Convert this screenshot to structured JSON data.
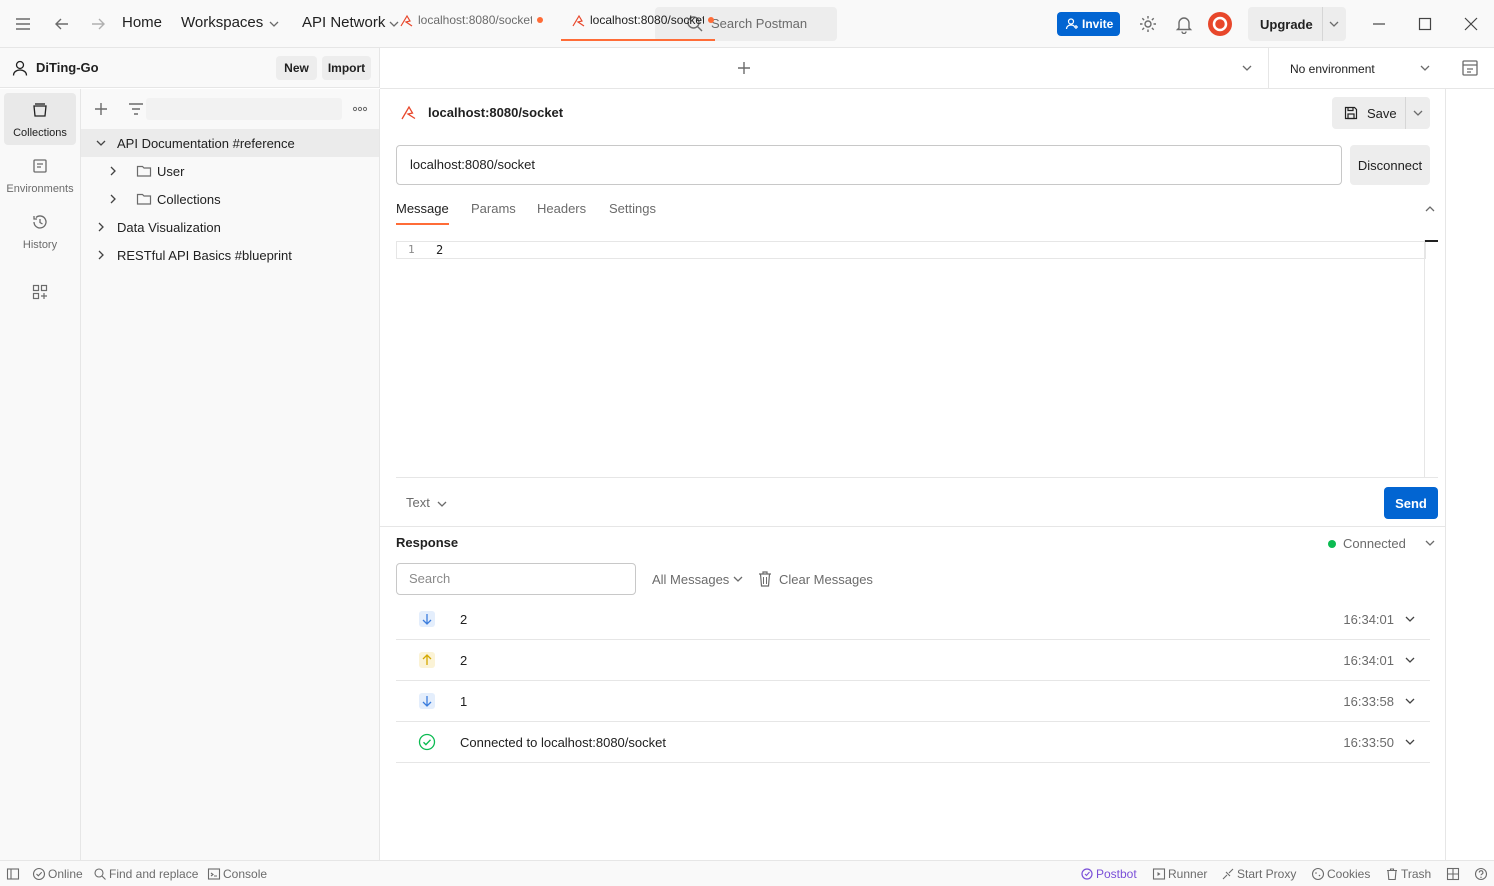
{
  "titlebar": {
    "home": "Home",
    "workspaces": "Workspaces",
    "api_network": "API Network",
    "search_placeholder": "Search Postman",
    "invite": "Invite",
    "upgrade": "Upgrade"
  },
  "workspace": {
    "name": "DiTing-Go",
    "new_label": "New",
    "import_label": "Import"
  },
  "rail": [
    {
      "label": "Collections"
    },
    {
      "label": "Environments"
    },
    {
      "label": "History"
    }
  ],
  "tree": [
    {
      "label": "API Documentation #reference"
    },
    {
      "label": "User"
    },
    {
      "label": "Collections"
    },
    {
      "label": "Data Visualization"
    },
    {
      "label": "RESTful API Basics #blueprint"
    }
  ],
  "tabs": [
    {
      "label": "localhost:8080/socket"
    },
    {
      "label": "localhost:8080/socket"
    }
  ],
  "environment": "No environment",
  "request": {
    "title": "localhost:8080/socket",
    "save": "Save",
    "url": "localhost:8080/socket",
    "disconnect": "Disconnect",
    "tabs": [
      "Message",
      "Params",
      "Headers",
      "Settings"
    ],
    "editor_line_number": "1",
    "editor_content": "2",
    "format": "Text",
    "send": "Send"
  },
  "response": {
    "title": "Response",
    "status": "Connected",
    "search_placeholder": "Search",
    "filter": "All Messages",
    "clear": "Clear Messages",
    "messages": [
      {
        "direction": "received",
        "text": "2",
        "time": "16:34:01"
      },
      {
        "direction": "sent",
        "text": "2",
        "time": "16:34:01"
      },
      {
        "direction": "received",
        "text": "1",
        "time": "16:33:58"
      },
      {
        "direction": "connected",
        "text": "Connected to localhost:8080/socket",
        "time": "16:33:50"
      }
    ]
  },
  "statusbar": {
    "online": "Online",
    "find_replace": "Find and replace",
    "console": "Console",
    "postbot": "Postbot",
    "runner": "Runner",
    "start_proxy": "Start Proxy",
    "cookies": "Cookies",
    "trash": "Trash"
  },
  "colors": {
    "accent": "#ff6c37",
    "primary_button": "#0265d2",
    "connected": "#0cbb52",
    "received_icon": "#3b7ddd",
    "sent_icon": "#d4a800"
  }
}
